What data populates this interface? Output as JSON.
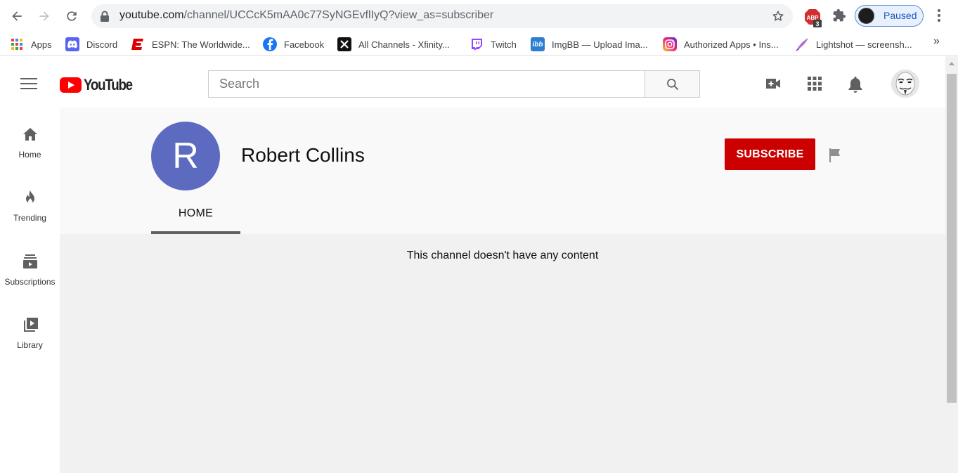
{
  "browser": {
    "url_host": "youtube.com",
    "url_path": "/channel/UCCcK5mAA0c77SyNGEvflIyQ?view_as=subscriber",
    "profile_label": "Paused",
    "abp_badge": "3",
    "abp_text": "ABP"
  },
  "bookmarks": [
    {
      "label": "Apps",
      "icon": "apps-grid-icon",
      "color": "#4285f4"
    },
    {
      "label": "Discord",
      "icon": "discord-icon",
      "color": "#5865f2"
    },
    {
      "label": "ESPN: The Worldwide...",
      "icon": "espn-icon",
      "color": "#d00"
    },
    {
      "label": "Facebook",
      "icon": "facebook-icon",
      "color": "#1877f2"
    },
    {
      "label": "All Channels - Xfinity...",
      "icon": "x-icon",
      "color": "#111"
    },
    {
      "label": "Twitch",
      "icon": "twitch-icon",
      "color": "#9146ff"
    },
    {
      "label": "ImgBB — Upload Ima...",
      "icon": "imgbb-icon",
      "color": "#2a7fd4"
    },
    {
      "label": "Authorized Apps • Ins...",
      "icon": "instagram-icon",
      "color": "#d6249f"
    },
    {
      "label": "Lightshot — screensh...",
      "icon": "lightshot-icon",
      "color": "#9b59b6"
    }
  ],
  "bookmark_more": "»",
  "youtube": {
    "logo_word": "YouTube",
    "search_placeholder": "Search"
  },
  "leftnav": [
    {
      "label": "Home"
    },
    {
      "label": "Trending"
    },
    {
      "label": "Subscriptions"
    },
    {
      "label": "Library"
    }
  ],
  "channel": {
    "initial": "R",
    "name": "Robert Collins",
    "subscribe_label": "SUBSCRIBE",
    "tab_home": "HOME",
    "empty_message": "This channel doesn't have any content"
  },
  "colors": {
    "subscribe": "#cc0000",
    "avatar": "#5c6bc0",
    "brand_red": "#ff0000"
  }
}
